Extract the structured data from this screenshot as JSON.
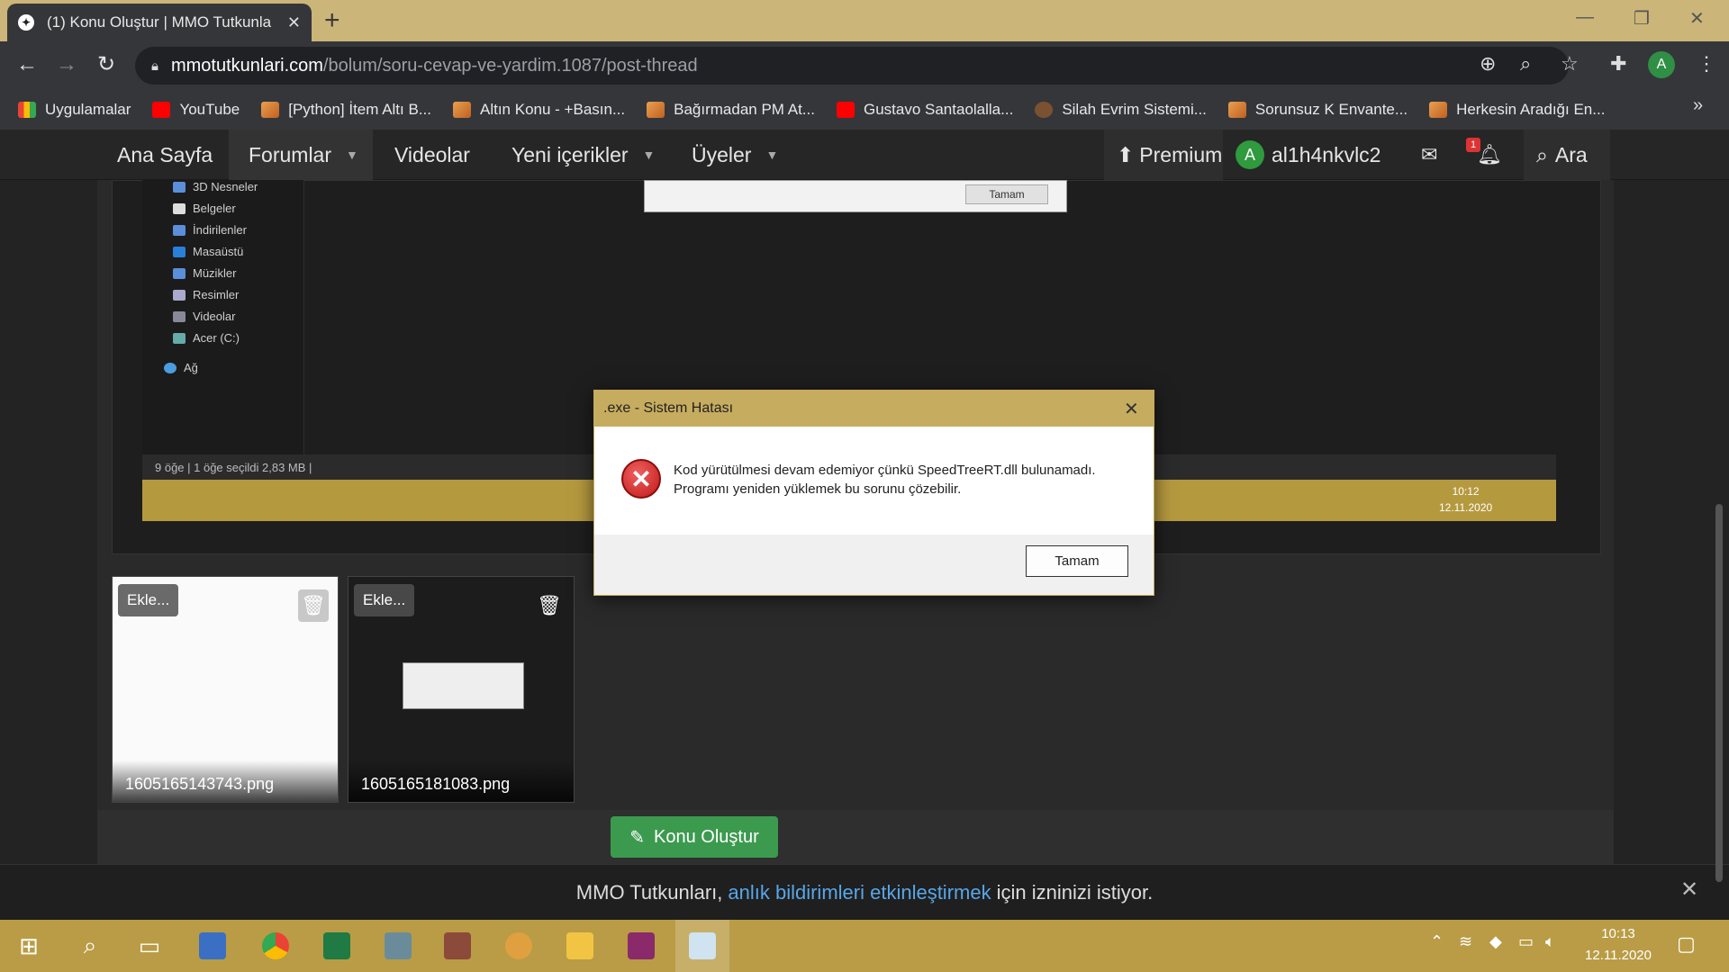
{
  "browser": {
    "tab_title": "(1) Konu Oluştur | MMO Tutkunla",
    "url_host": "mmotutkunlari.com",
    "url_path": "/bolum/soru-cevap-ve-yardim.1087/post-thread",
    "profile_initial": "A",
    "bookmarks": [
      {
        "label": "Uygulamalar",
        "icon": "grid"
      },
      {
        "label": "YouTube",
        "icon": "yt"
      },
      {
        "label": "[Python] İtem Altı B...",
        "icon": "mmo"
      },
      {
        "label": "Altın Konu - +Basın...",
        "icon": "mmo"
      },
      {
        "label": "Bağırmadan PM At...",
        "icon": "mmo"
      },
      {
        "label": "Gustavo Santaolalla...",
        "icon": "yt"
      },
      {
        "label": "Silah Evrim Sistemi...",
        "icon": "sil"
      },
      {
        "label": "Sorunsuz K Envante...",
        "icon": "mmo"
      },
      {
        "label": "Herkesin Aradığı En...",
        "icon": "mmo"
      }
    ]
  },
  "site_nav": {
    "home": "Ana Sayfa",
    "forums": "Forumlar",
    "videos": "Videolar",
    "new_content": "Yeni içerikler",
    "members": "Üyeler",
    "premium": "Premium",
    "user_initial": "A",
    "username": "al1h4nkvlc2",
    "alerts_badge": "1",
    "search": "Ara"
  },
  "embedded_screenshot": {
    "explorer_items": [
      "3D Nesneler",
      "Belgeler",
      "İndirilenler",
      "Masaüstü",
      "Müzikler",
      "Resimler",
      "Videolar",
      "Acer (C:)",
      "Ağ"
    ],
    "status": "9 öğe  |  1 öğe seçildi  2,83 MB  |",
    "top_dialog_button": "Tamam",
    "inner_clock_time": "10:12",
    "inner_clock_date": "12.11.2020"
  },
  "attachments": [
    {
      "ekle": "Ekle...",
      "filename": "1605165143743.png"
    },
    {
      "ekle": "Ekle...",
      "filename": "1605165181083.png"
    }
  ],
  "submit_label": "Konu Oluştur",
  "notification": {
    "before": "MMO Tutkunları,",
    "link": "anlık bildirimleri etkinleştirmek",
    "after": "için izninizi istiyor."
  },
  "error_dialog": {
    "title": ".exe - Sistem Hatası",
    "line1": "Kod yürütülmesi devam edemiyor çünkü SpeedTreeRT.dll bulunamadı.",
    "line2": "Programı yeniden yüklemek bu sorunu çözebilir.",
    "ok": "Tamam"
  },
  "taskbar": {
    "time": "10:13",
    "date": "12.11.2020"
  },
  "colors": {
    "accent_gold": "#c6ac5f",
    "submit_green": "#3c9a4f",
    "link_blue": "#58a6e8"
  }
}
